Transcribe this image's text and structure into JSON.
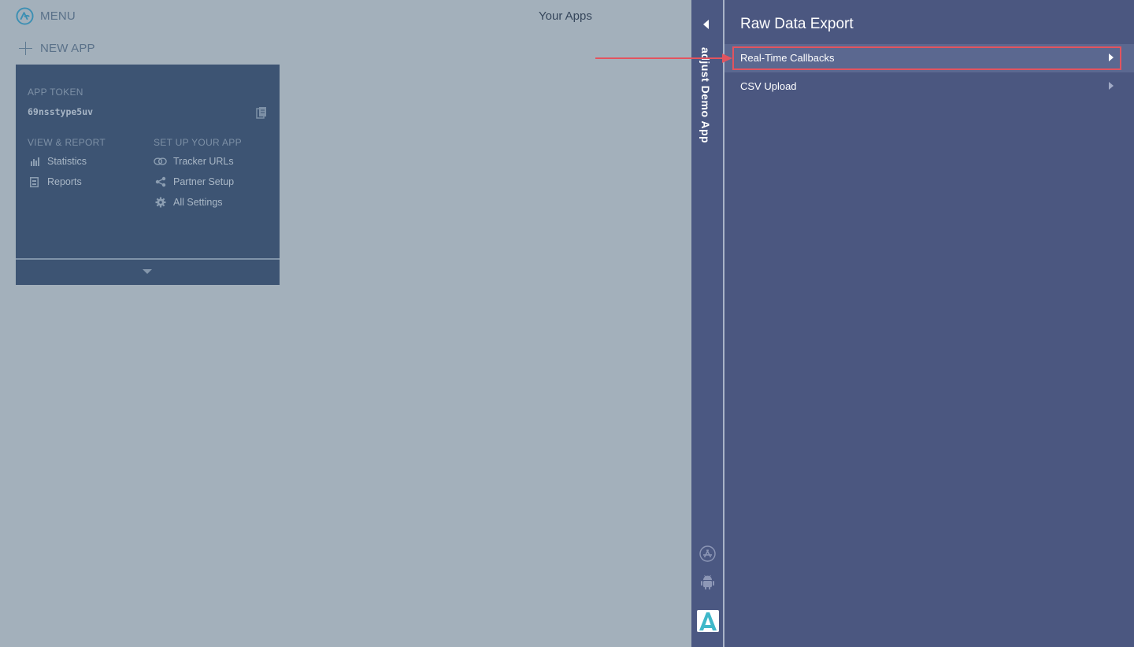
{
  "header": {
    "menu_label": "MENU",
    "page_title": "Your Apps",
    "new_app_label": "NEW APP"
  },
  "app_card": {
    "token_label": "APP TOKEN",
    "token_value": "69nsstype5uv",
    "view_report_title": "VIEW & REPORT",
    "setup_title": "SET UP YOUR APP",
    "view_links": [
      {
        "label": "Statistics",
        "icon": "bar-chart-icon"
      },
      {
        "label": "Reports",
        "icon": "report-icon"
      }
    ],
    "setup_links": [
      {
        "label": "Tracker URLs",
        "icon": "link-icon"
      },
      {
        "label": "Partner Setup",
        "icon": "share-icon"
      },
      {
        "label": "All Settings",
        "icon": "gear-icon"
      }
    ]
  },
  "side_strip": {
    "app_name": "adjust Demo App",
    "icons": [
      "app-store-icon",
      "android-icon",
      "adjust-logo-icon"
    ]
  },
  "panel": {
    "title": "Raw Data Export",
    "items": [
      {
        "label": "Real-Time Callbacks",
        "selected": true
      },
      {
        "label": "CSV Upload",
        "selected": false
      }
    ]
  },
  "colors": {
    "background": "#a3b0bb",
    "card": "#3d5473",
    "panel": "#4b5780",
    "highlight": "#e2545f",
    "accent_teal": "#3fb8c9"
  }
}
